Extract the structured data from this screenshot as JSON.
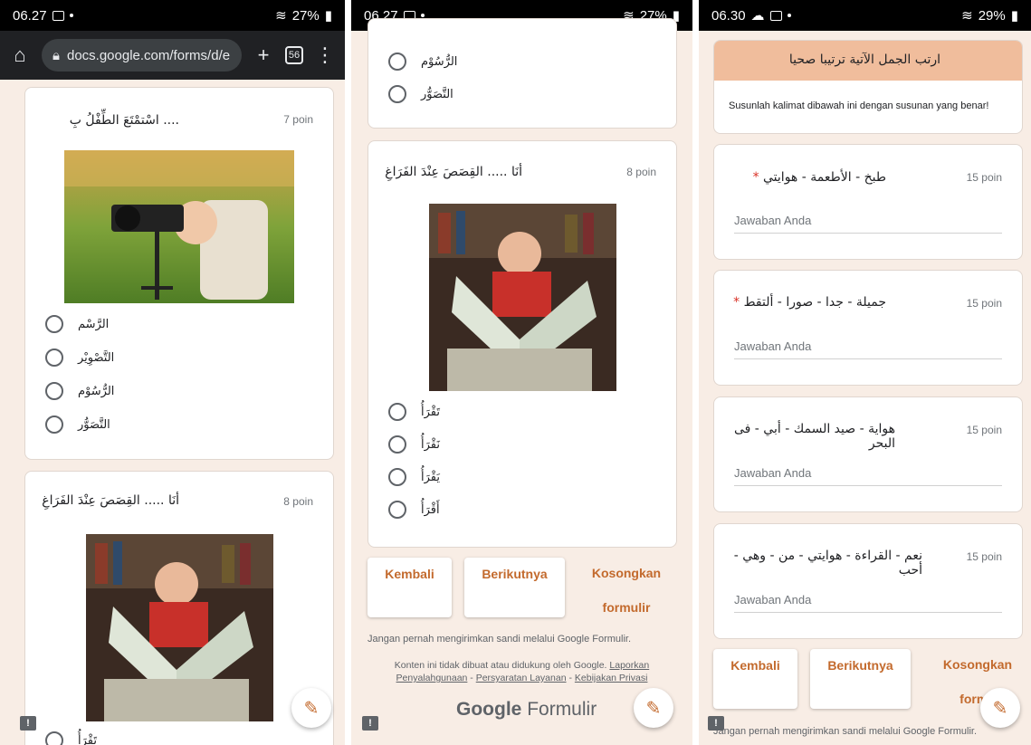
{
  "screen1": {
    "status": {
      "time": "06.27",
      "signal": "27%"
    },
    "browser": {
      "url": "docs.google.com/forms/d/e",
      "tab_count": "56"
    },
    "q7": {
      "title": ".... اسْتمْتَعَ الطِّفْلُ بِ",
      "points": "7 poin",
      "options": [
        "الرَّسْم",
        "التَّصْوِيْر",
        "الرُّسُوْم",
        "التَّصَوُّر"
      ]
    },
    "q8": {
      "title": "أنَا ..... القِصَصَ عِنْدَ الفَرَاغِ",
      "points": "8 poin",
      "partial_option": "تَقْرَأُ"
    }
  },
  "screen2": {
    "status": {
      "time": "06.27",
      "signal": "27%"
    },
    "top_options": [
      "الرُّسُوْم",
      "التَّصَوُّر"
    ],
    "q8": {
      "title": "أنَا ..... القِصَصَ عِنْدَ الفَرَاغِ",
      "points": "8 poin",
      "options": [
        "تَقْرَأُ",
        "نَقْرَأُ",
        "يَقْرَأُ",
        "أَقْرَأُ"
      ]
    },
    "buttons": {
      "back": "Kembali",
      "next": "Berikutnya",
      "clear_1": "Kosongkan",
      "clear_2": "formulir"
    },
    "warning": "Jangan pernah mengirimkan sandi melalui Google Formulir.",
    "disclaimer_1": "Konten ini tidak dibuat atau didukung oleh Google.",
    "link_report_1": "Laporkan",
    "link_report_2": "Penyalahgunaan",
    "dash_1": "-",
    "link_terms": "Persyaratan Layanan",
    "dash_2": "-",
    "link_privacy": "Kebijakan Privasi",
    "logo_google": "Google",
    "logo_forms": "Formulir"
  },
  "screen3": {
    "status": {
      "time": "06.30",
      "signal": "29%"
    },
    "header_title": "ارتب الجمل الآتية ترتيبا صحيا",
    "description": "Susunlah kalimat dibawah ini dengan susunan yang benar!",
    "questions": [
      {
        "title": "طبخ - الأطعمة - هوايتي",
        "required": "*",
        "points": "15 poin",
        "hint": "Jawaban Anda"
      },
      {
        "title": "جميلة - جدا - صورا - ألتقط",
        "required": "*",
        "points": "15 poin",
        "hint": "Jawaban Anda"
      },
      {
        "title": "هواية - صيد السمك - أبي - فى البحر",
        "required": "",
        "points": "15 poin",
        "hint": "Jawaban Anda"
      },
      {
        "title": "نعم - القراءة - هوايتي - من - وهي - أحب",
        "required": "",
        "points": "15 poin",
        "hint": "Jawaban Anda"
      }
    ],
    "buttons": {
      "back": "Kembali",
      "next": "Berikutnya",
      "clear_1": "Kosongkan",
      "clear_2": "formu"
    },
    "warning": "Jangan pernah mengirimkan sandi melalui Google Formulir."
  },
  "colors": {
    "accent": "#c36a2d",
    "header": "#f0bd9c",
    "background": "#f8ede5"
  },
  "icons": [
    "home-icon",
    "lock-icon",
    "plus-icon",
    "tabs-icon",
    "menu-dots-icon",
    "pencil-icon",
    "feedback-icon",
    "wifi-icon",
    "battery-icon"
  ]
}
